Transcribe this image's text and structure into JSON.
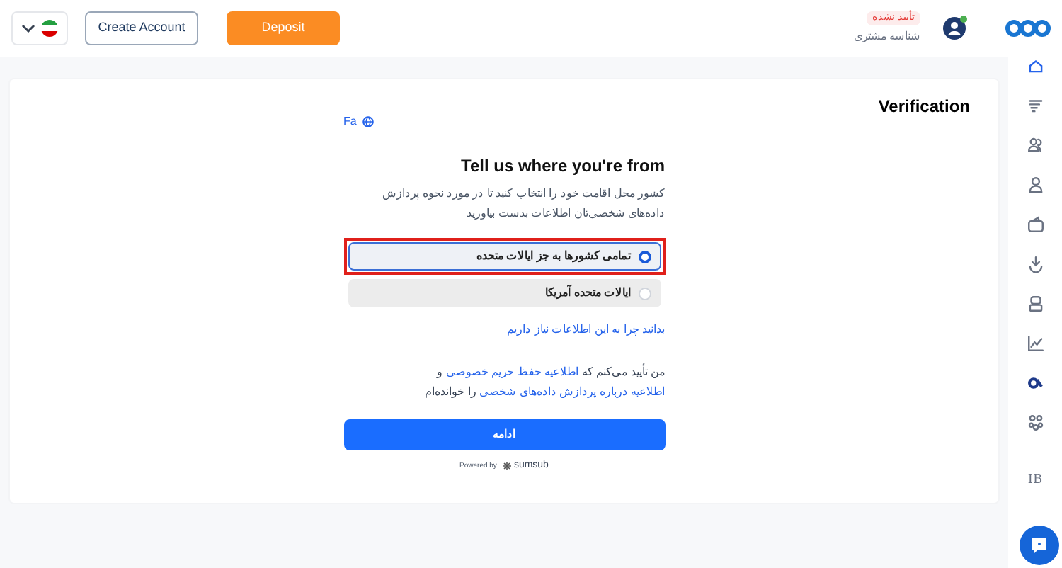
{
  "header": {
    "language_flag": true,
    "create_account": "Create Account",
    "deposit": "Deposit",
    "user": {
      "status": "تأیید نشده",
      "label": "شناسه مشتری",
      "online": true
    }
  },
  "sidebar": {
    "items": [
      {
        "kind": "icon",
        "selected": true
      },
      {
        "kind": "icon",
        "selected": false
      },
      {
        "kind": "icon",
        "selected": false
      },
      {
        "kind": "icon",
        "selected": false
      },
      {
        "kind": "icon",
        "selected": false
      },
      {
        "kind": "icon",
        "selected": false
      },
      {
        "kind": "icon",
        "selected": false
      },
      {
        "kind": "icon",
        "selected": false
      },
      {
        "kind": "icon",
        "selected": false
      },
      {
        "kind": "icon",
        "selected": false
      },
      {
        "kind": "text",
        "label": "IB",
        "selected": false
      }
    ]
  },
  "page": {
    "title": "Verification"
  },
  "form": {
    "language": "Fa",
    "heading": "Tell us where you're from",
    "description": "کشور محل اقامت خود را انتخاب کنید تا در مورد نحوه پردازش داده‌های شخصی‌تان اطلاعات بدست بیاورید",
    "options": [
      {
        "label": "تمامی کشورها به جز ایالات متحده",
        "selected": true,
        "highlighted": true
      },
      {
        "label": "ایالات متحده آمریکا",
        "selected": false,
        "highlighted": false
      }
    ],
    "why_link": "بدانید چرا به این اطلاعات نیاز داریم",
    "consent": [
      {
        "text": "من تأیید می‌کنم که",
        "link": false
      },
      {
        "text": "اطلاعیه حفظ حریم خصوصی",
        "link": true
      },
      {
        "text": "و",
        "link": false
      },
      {
        "text": "اطلاعیه درباره پردازش داده‌های شخصی",
        "link": true
      },
      {
        "text": "را خوانده‌ام",
        "link": false
      }
    ],
    "continue": "ادامه",
    "powered_by": "Powered by",
    "brand": "sumsub"
  }
}
